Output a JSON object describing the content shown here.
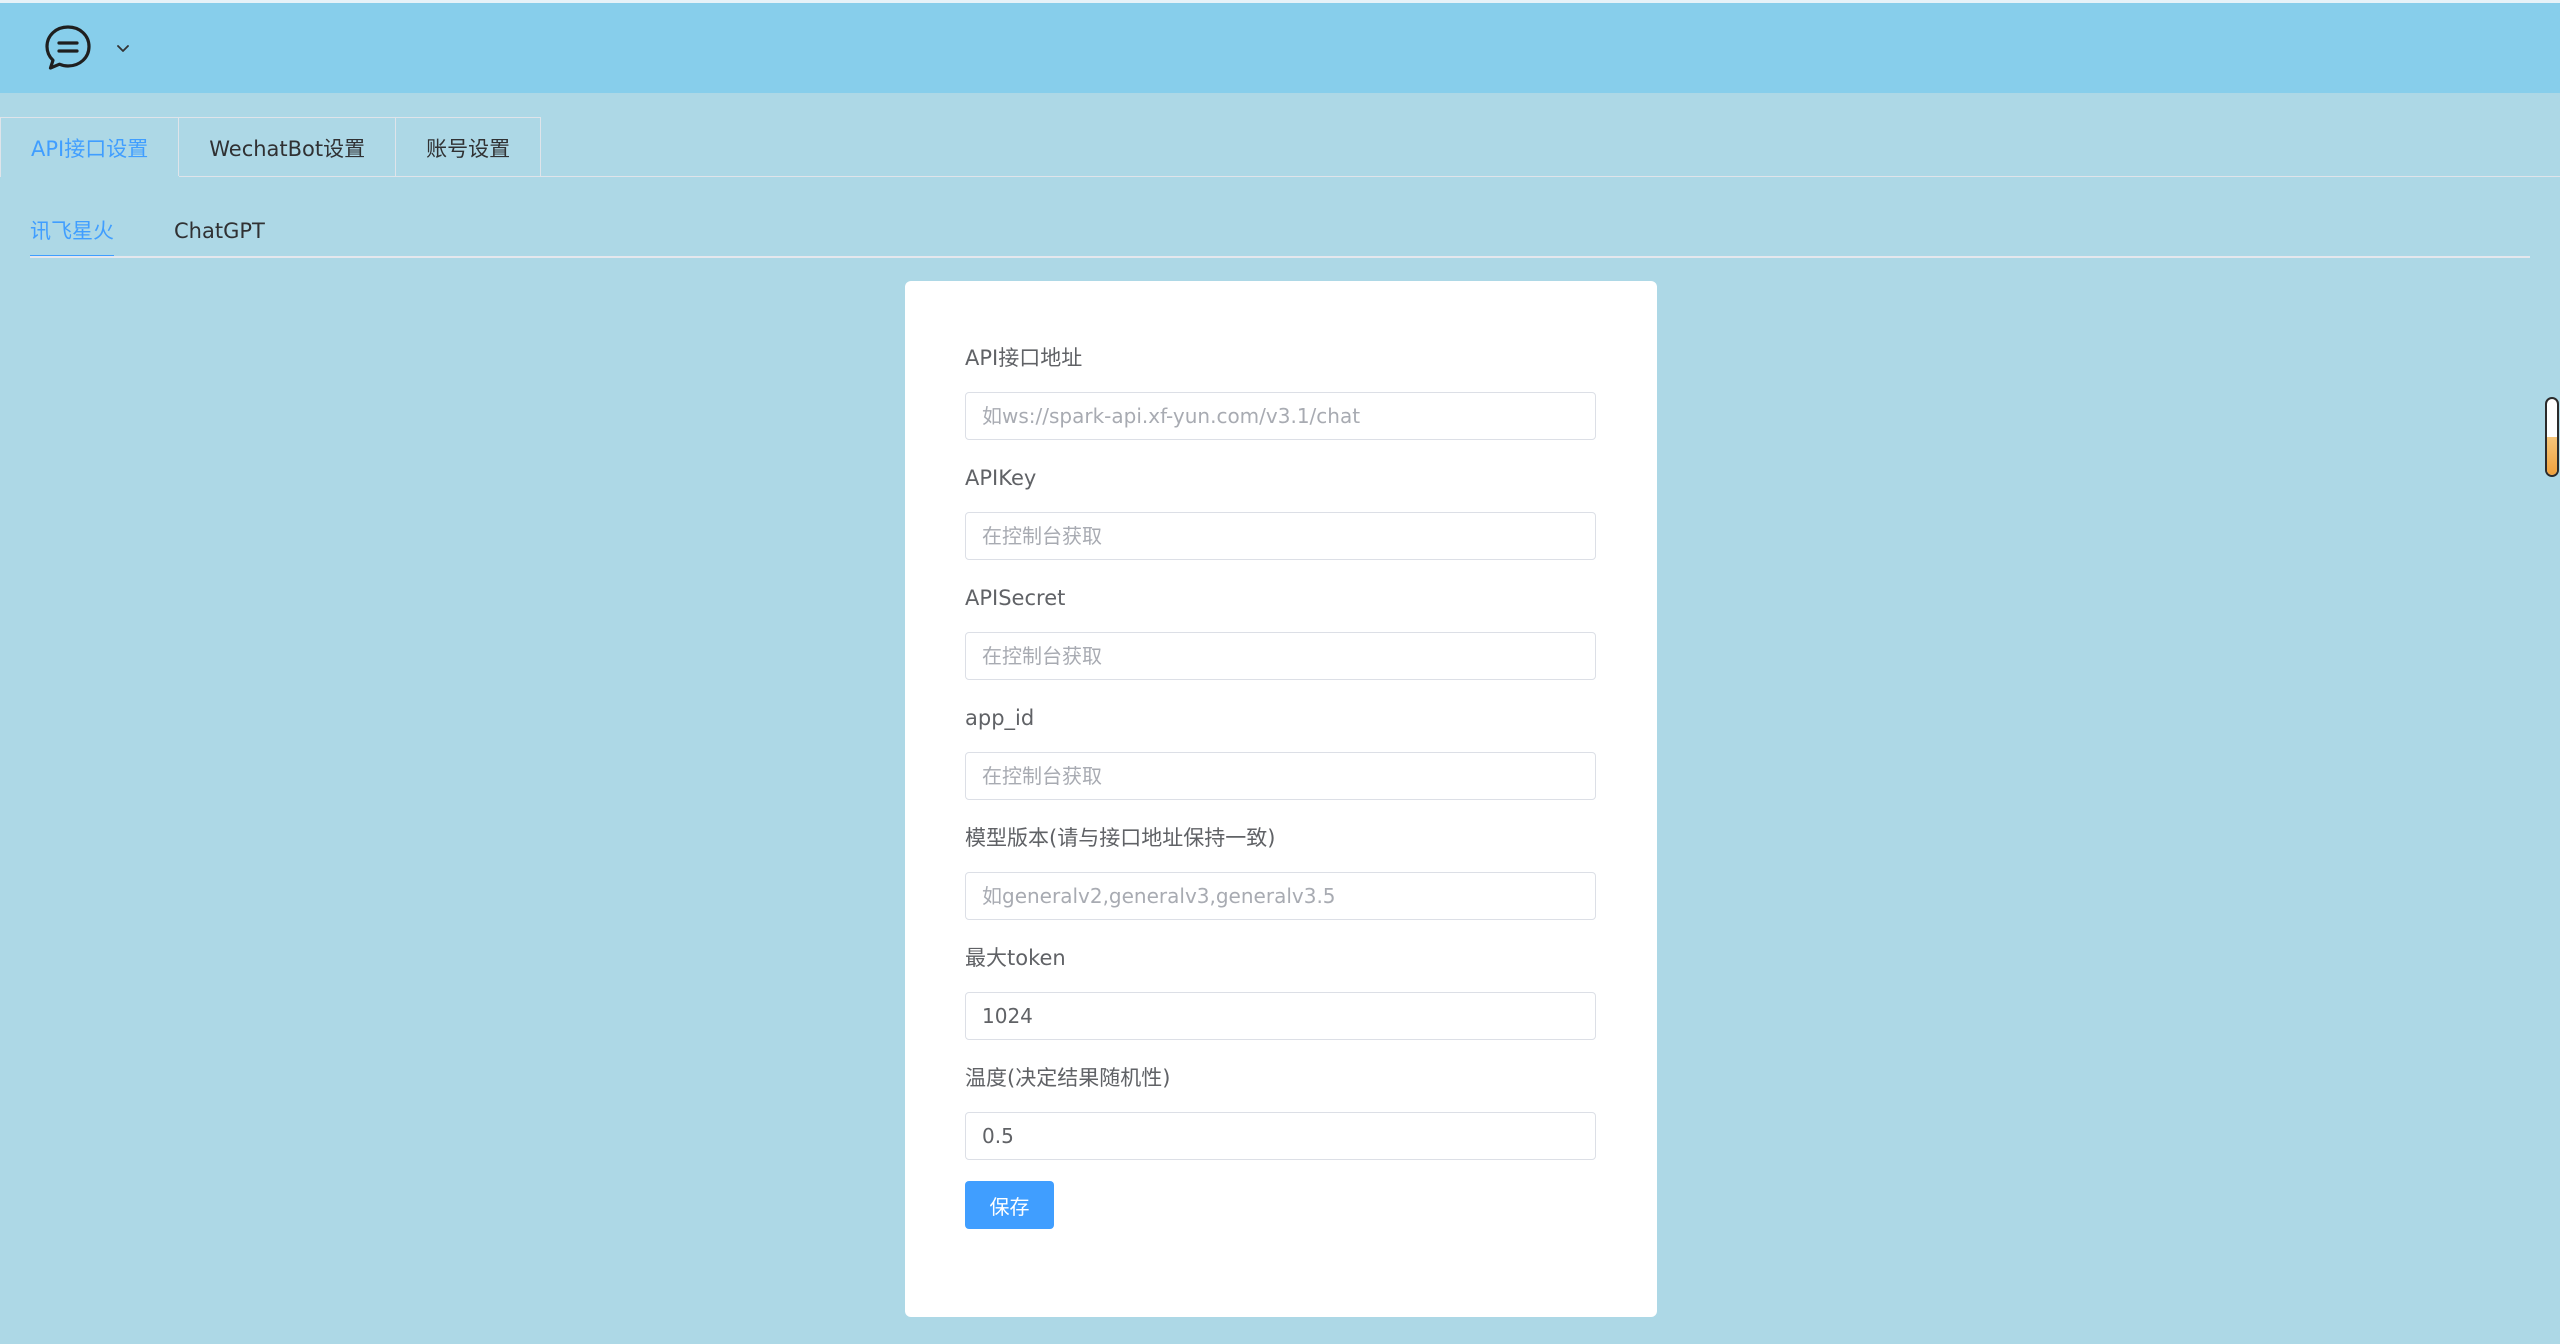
{
  "header": {
    "logo_icon": "chat-bubble-icon",
    "menu_icon": "chevron-down-icon"
  },
  "main_tabs": [
    {
      "label": "API接口设置",
      "active": true
    },
    {
      "label": "WechatBot设置",
      "active": false
    },
    {
      "label": "账号设置",
      "active": false
    }
  ],
  "sub_tabs": [
    {
      "label": "讯飞星火",
      "active": true
    },
    {
      "label": "ChatGPT",
      "active": false
    }
  ],
  "form": {
    "fields": [
      {
        "label": "API接口地址",
        "value": "",
        "placeholder": "如ws://spark-api.xf-yun.com/v3.1/chat"
      },
      {
        "label": "APIKey",
        "value": "",
        "placeholder": "在控制台获取"
      },
      {
        "label": "APISecret",
        "value": "",
        "placeholder": "在控制台获取"
      },
      {
        "label": "app_id",
        "value": "",
        "placeholder": "在控制台获取"
      },
      {
        "label": "模型版本(请与接口地址保持一致)",
        "value": "",
        "placeholder": "如generalv2,generalv3,generalv3.5"
      },
      {
        "label": "最大token",
        "value": "1024",
        "placeholder": ""
      },
      {
        "label": "温度(决定结果随机性)",
        "value": "0.5",
        "placeholder": ""
      }
    ],
    "save_label": "保存"
  },
  "colors": {
    "header_bg": "#87ceeb",
    "page_bg": "#add8e6",
    "accent": "#409eff"
  }
}
